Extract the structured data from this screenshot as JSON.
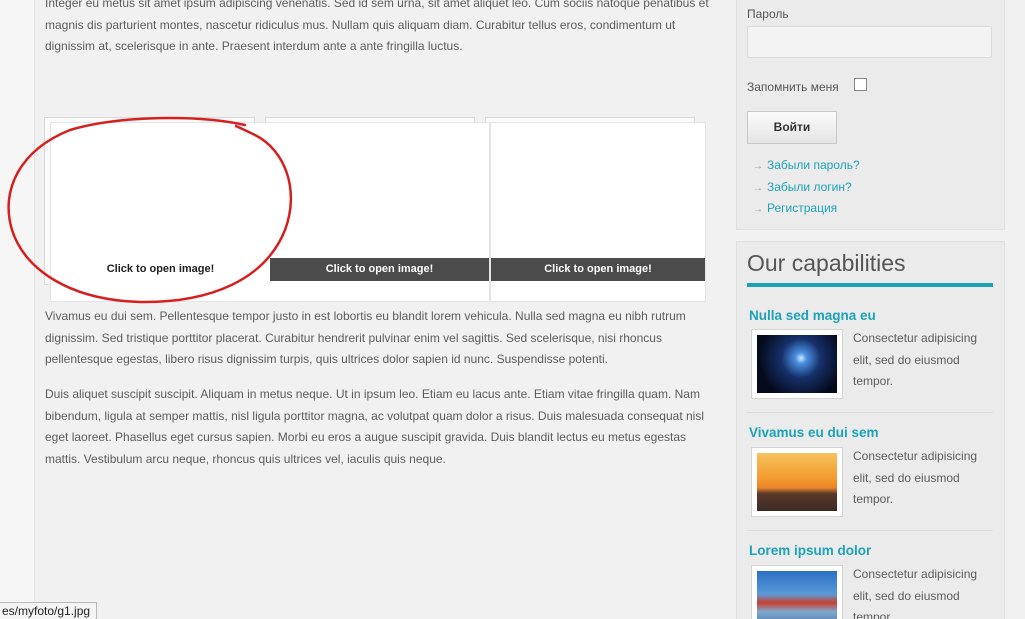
{
  "main": {
    "para1": "Integer eu metus sit amet ipsum adipiscing venenatis. Sed id sem urna, sit amet aliquet leo. Cum sociis natoque penatibus et magnis dis parturient montes, nascetur ridiculus mus. Nullam quis aliquam diam. Curabitur tellus eros, condimentum ut dignissim at, scelerisque in ante. Praesent interdum ante a ante fringilla luctus.",
    "para2": "Vivamus eu dui sem. Pellentesque tempor justo in est lobortis eu blandit lorem vehicula. Nulla sed magna eu nibh rutrum dignissim. Sed tristique porttitor placerat. Curabitur hendrerit pulvinar enim vel sagittis. Sed scelerisque, nisi rhoncus pellentesque egestas, libero risus dignissim turpis, quis ultrices dolor sapien id nunc. Suspendisse potenti.",
    "para3": "Duis aliquet suscipit suscipit. Aliquam in metus neque. Ut in ipsum leo. Etiam eu lacus ante. Etiam vitae fringilla quam. Nam bibendum, ligula at semper mattis, nisl ligula porttitor magna, ac volutpat quam dolor a risus. Duis malesuada consequat nisl eget laoreet. Phasellus eget cursus sapien. Morbi eu eros a augue suscipit gravida. Duis blandit lectus eu metus egestas mattis. Vestibulum arcu neque, rhoncus quis ultrices vel, iaculis quis neque.",
    "gallery": [
      {
        "caption": "Click to open image!"
      },
      {
        "caption": "Click to open image!"
      },
      {
        "caption": "Click to open image!"
      }
    ],
    "annotation_color": "#d42020"
  },
  "login": {
    "password_label": "Пароль",
    "remember_label": "Запомнить меня",
    "login_button": "Войти",
    "links": [
      "Забыли пароль?",
      "Забыли логин?",
      "Регистрация"
    ]
  },
  "capabilities": {
    "title": "Our capabilities",
    "accent": "#1ca3b8",
    "items": [
      {
        "title": "Nulla sed magna eu",
        "text": "Consectetur adipisicing elit, sed do eiusmod tempor.",
        "image": "welder-sparks-icon"
      },
      {
        "title": "Vivamus eu dui sem",
        "text": "Consectetur adipisicing elit, sed do eiusmod tempor.",
        "image": "port-cranes-sunset-icon"
      },
      {
        "title": "Lorem ipsum dolor",
        "text": "Consectetur adipisicing elit, sed do eiusmod tempor.",
        "image": "harbor-worker-icon"
      }
    ]
  },
  "status_bar": {
    "url": "es/myfoto/g1.jpg"
  }
}
